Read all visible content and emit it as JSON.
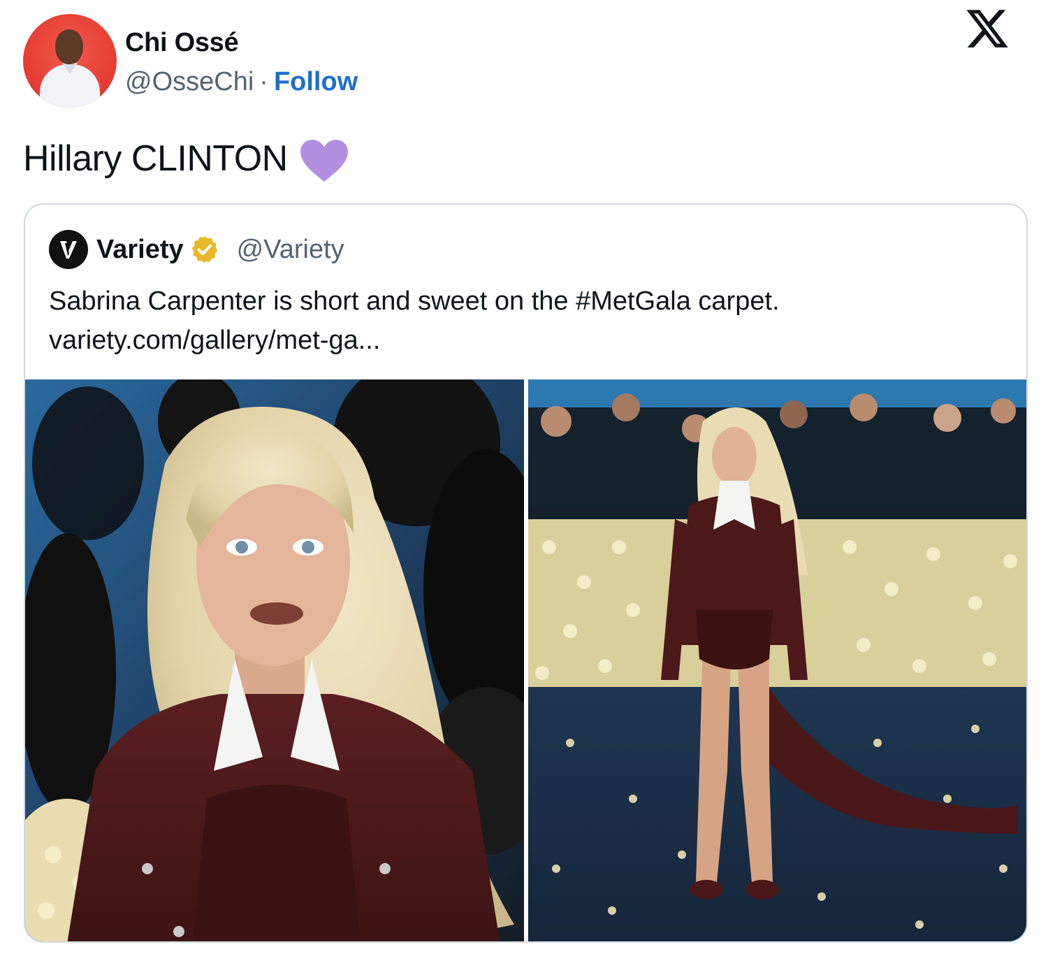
{
  "author": {
    "name": "Chi Ossé",
    "handle": "@OsseChi",
    "separator": "·",
    "follow_label": "Follow",
    "avatar_icon": "profile-photo"
  },
  "platform": {
    "logo_icon": "x-logo"
  },
  "tweet": {
    "text": "Hillary CLINTON",
    "emoji_icon": "purple-heart-icon",
    "emoji_color": "#b38fe0"
  },
  "quoted": {
    "name": "Variety",
    "handle": "@Variety",
    "verified_icon": "gold-verified-badge-icon",
    "logo_icon": "variety-v-logo",
    "text_line1": "Sabrina Carpenter is short and sweet on the #MetGala carpet.",
    "text_line2": "variety.com/gallery/met-ga...",
    "images": [
      "close-up-portrait-photo",
      "full-length-red-carpet-photo"
    ]
  },
  "colors": {
    "follow_blue": "#1d6fc9",
    "secondary_text": "#536471",
    "border": "#cfd9de",
    "verified_gold": "#e8b829"
  }
}
